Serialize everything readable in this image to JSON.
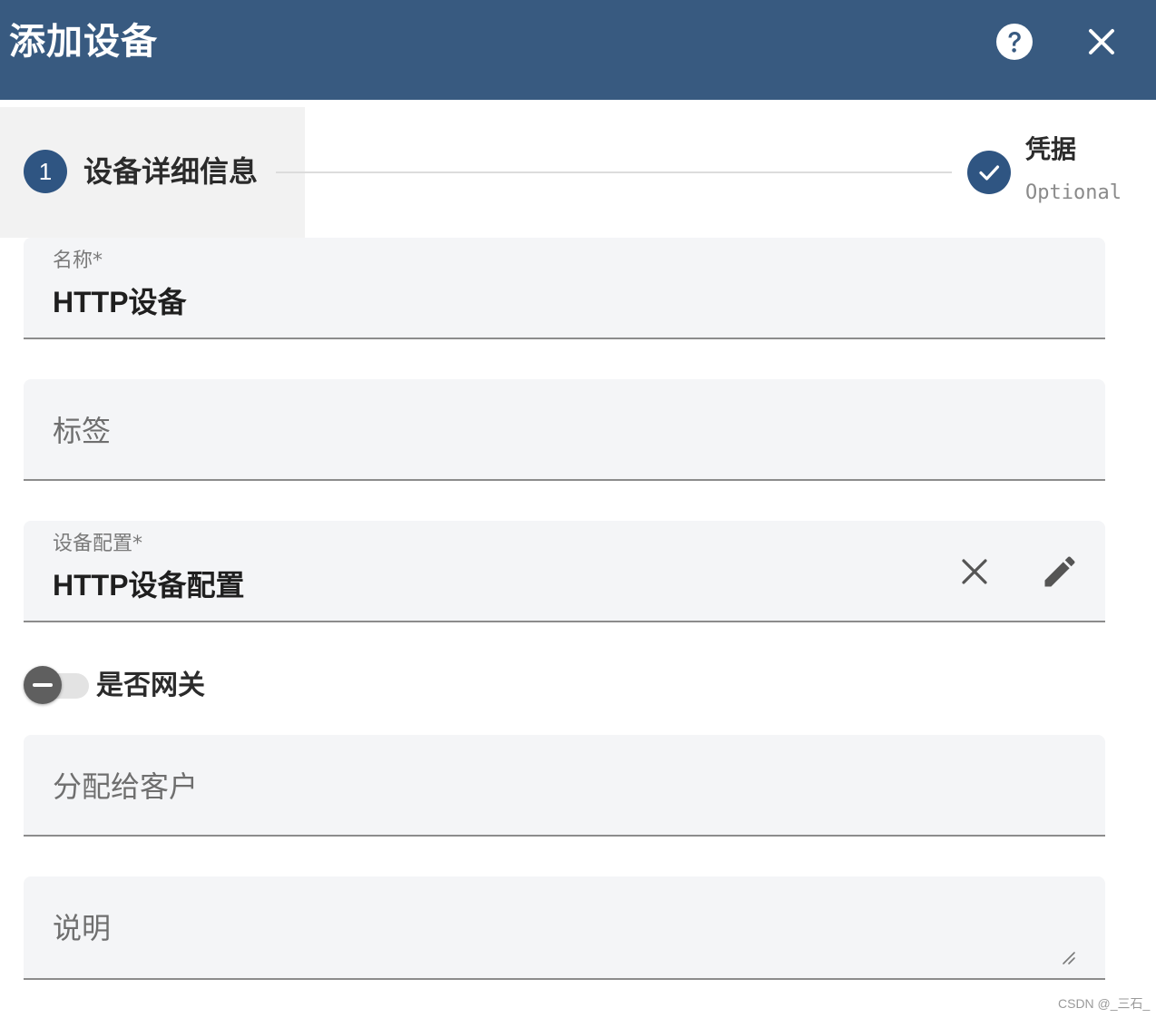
{
  "dialog": {
    "title": "添加设备",
    "header_color": "#385a80",
    "icons": [
      "help-icon",
      "close-icon"
    ]
  },
  "stepper": {
    "steps": [
      {
        "number": "1",
        "label": "设备详细信息",
        "state": "active"
      },
      {
        "label": "凭据",
        "sublabel": "Optional",
        "state": "done",
        "icon": "check-icon"
      }
    ],
    "accent_color": "#2f5582"
  },
  "form": {
    "name": {
      "label": "名称*",
      "value": "HTTP设备"
    },
    "tags": {
      "placeholder": "标签"
    },
    "device_profile": {
      "label": "设备配置*",
      "value": "HTTP设备配置",
      "icons": [
        "clear-icon",
        "edit-icon"
      ]
    },
    "gateway": {
      "label": "是否网关",
      "checked": false
    },
    "customer": {
      "placeholder": "分配给客户"
    },
    "description": {
      "placeholder": "说明"
    }
  },
  "watermark": "CSDN @_三石_"
}
